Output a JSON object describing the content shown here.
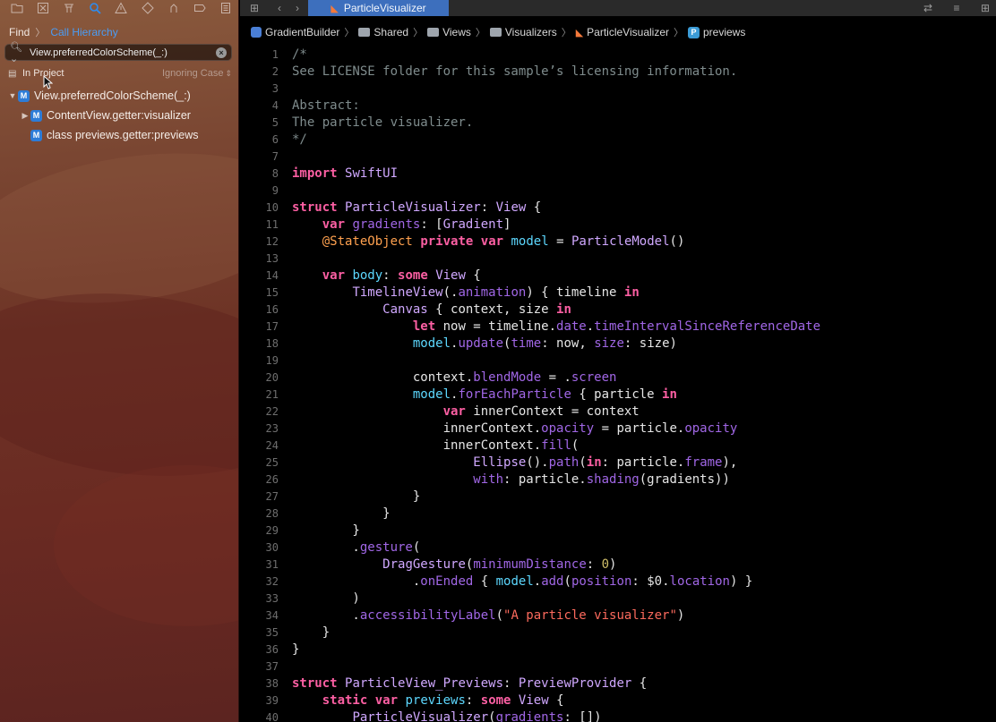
{
  "navigator_toolbar": {
    "icons": [
      "folder-icon",
      "source-control-icon",
      "symbol-icon",
      "find-icon",
      "issue-icon",
      "test-icon",
      "debug-icon",
      "breakpoint-icon",
      "report-icon"
    ]
  },
  "find_bar": {
    "find_label": "Find",
    "mode": "Call Hierarchy",
    "search_value": "View.preferredColorScheme(_:)",
    "scope": "In Project",
    "case_mode": "Ignoring Case"
  },
  "tree": [
    {
      "label": "View.preferredColorScheme(_:)",
      "badge": "M",
      "expanded": true,
      "level": 0
    },
    {
      "label": "ContentView.getter:visualizer",
      "badge": "M",
      "expanded": false,
      "level": 1
    },
    {
      "label": "class previews.getter:previews",
      "badge": "M",
      "expanded": false,
      "level": 1
    }
  ],
  "tabbar": {
    "active_tab": "ParticleVisualizer"
  },
  "jumpbar": {
    "crumbs": [
      "GradientBuilder",
      "Shared",
      "Views",
      "Visualizers",
      "ParticleVisualizer",
      "previews"
    ]
  },
  "code": {
    "lines": [
      {
        "n": "1",
        "t": "/*"
      },
      {
        "n": "2",
        "t": "See LICENSE folder for this sample’s licensing information."
      },
      {
        "n": "3",
        "t": ""
      },
      {
        "n": "4",
        "t": "Abstract:"
      },
      {
        "n": "5",
        "t": "The particle visualizer."
      },
      {
        "n": "6",
        "t": "*/"
      },
      {
        "n": "7",
        "t": ""
      },
      {
        "n": "8",
        "t": "import SwiftUI"
      },
      {
        "n": "9",
        "t": ""
      },
      {
        "n": "10",
        "t": "struct ParticleVisualizer: View {"
      },
      {
        "n": "11",
        "t": "    var gradients: [Gradient]"
      },
      {
        "n": "12",
        "t": "    @StateObject private var model = ParticleModel()"
      },
      {
        "n": "13",
        "t": ""
      },
      {
        "n": "14",
        "t": "    var body: some View {"
      },
      {
        "n": "15",
        "t": "        TimelineView(.animation) { timeline in"
      },
      {
        "n": "16",
        "t": "            Canvas { context, size in"
      },
      {
        "n": "17",
        "t": "                let now = timeline.date.timeIntervalSinceReferenceDate"
      },
      {
        "n": "18",
        "t": "                model.update(time: now, size: size)"
      },
      {
        "n": "19",
        "t": ""
      },
      {
        "n": "20",
        "t": "                context.blendMode = .screen"
      },
      {
        "n": "21",
        "t": "                model.forEachParticle { particle in"
      },
      {
        "n": "22",
        "t": "                    var innerContext = context"
      },
      {
        "n": "23",
        "t": "                    innerContext.opacity = particle.opacity"
      },
      {
        "n": "24",
        "t": "                    innerContext.fill("
      },
      {
        "n": "25",
        "t": "                        Ellipse().path(in: particle.frame),"
      },
      {
        "n": "26",
        "t": "                        with: particle.shading(gradients))"
      },
      {
        "n": "27",
        "t": "                }"
      },
      {
        "n": "28",
        "t": "            }"
      },
      {
        "n": "29",
        "t": "        }"
      },
      {
        "n": "30",
        "t": "        .gesture("
      },
      {
        "n": "31",
        "t": "            DragGesture(minimumDistance: 0)"
      },
      {
        "n": "32",
        "t": "                .onEnded { model.add(position: $0.location) }"
      },
      {
        "n": "33",
        "t": "        )"
      },
      {
        "n": "34",
        "t": "        .accessibilityLabel(\"A particle visualizer\")"
      },
      {
        "n": "35",
        "t": "    }"
      },
      {
        "n": "36",
        "t": "}"
      },
      {
        "n": "37",
        "t": ""
      },
      {
        "n": "38",
        "t": "struct ParticleView_Previews: PreviewProvider {"
      },
      {
        "n": "39",
        "t": "    static var previews: some View {"
      },
      {
        "n": "40",
        "t": "        ParticleVisualizer(gradients: [])"
      }
    ]
  },
  "colors": {
    "keyword": "#fc5fa3",
    "type": "#d0a8ff",
    "comment": "#7f8c8d",
    "accent": "#3d6fbd"
  }
}
